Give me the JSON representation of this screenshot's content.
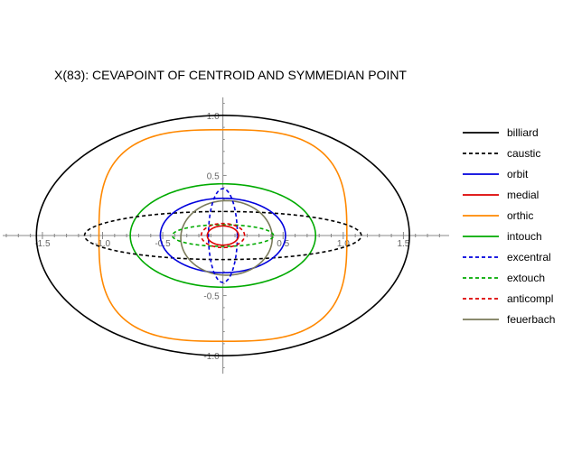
{
  "chart_data": {
    "type": "line",
    "title": "X(83): CEVAPOINT OF CENTROID AND SYMMEDIAN POINT",
    "xlabel": "",
    "ylabel": "",
    "xlim": [
      -1.83,
      1.88
    ],
    "ylim": [
      -1.15,
      1.15
    ],
    "aspect": "equal",
    "grid": false,
    "legend_position": "right",
    "x_ticks": [
      {
        "value": -1.5,
        "label": "-1.5"
      },
      {
        "value": -1.0,
        "label": "-1.0"
      },
      {
        "value": -0.5,
        "label": "-0.5"
      },
      {
        "value": 0.5,
        "label": "0.5"
      },
      {
        "value": 1.0,
        "label": "1.0"
      },
      {
        "value": 1.5,
        "label": "1.5"
      }
    ],
    "y_ticks": [
      {
        "value": 1.0,
        "label": "1.0"
      },
      {
        "value": 0.5,
        "label": "0.5"
      },
      {
        "value": -0.5,
        "label": "-0.5"
      },
      {
        "value": -1.0,
        "label": "-1.0"
      }
    ],
    "series": [
      {
        "name": "billiard",
        "color": "#000000",
        "dashed": false,
        "shape": "ellipse",
        "cx": 0,
        "cy": 0,
        "rx": 1.55,
        "ry": 1.0
      },
      {
        "name": "caustic",
        "color": "#000000",
        "dashed": true,
        "shape": "ellipse",
        "cx": 0,
        "cy": 0,
        "rx": 1.15,
        "ry": 0.2
      },
      {
        "name": "orbit",
        "color": "#0000dd",
        "dashed": false,
        "shape": "ellipse",
        "cx": 0,
        "cy": 0,
        "rx": 0.52,
        "ry": 0.31
      },
      {
        "name": "medial",
        "color": "#dd0000",
        "dashed": false,
        "shape": "ellipse",
        "cx": 0,
        "cy": 0,
        "rx": 0.13,
        "ry": 0.08
      },
      {
        "name": "orthic",
        "color": "#ff8800",
        "dashed": false,
        "shape": "superellipse",
        "cx": 0,
        "cy": 0,
        "rx": 1.03,
        "ry": 0.88,
        "n": 3
      },
      {
        "name": "intouch",
        "color": "#00aa00",
        "dashed": false,
        "shape": "ellipse",
        "cx": 0,
        "cy": 0,
        "rx": 0.77,
        "ry": 0.43
      },
      {
        "name": "excentral",
        "color": "#0000dd",
        "dashed": true,
        "shape": "ellipse",
        "cx": 0,
        "cy": 0,
        "rx": 0.12,
        "ry": 0.39
      },
      {
        "name": "extouch",
        "color": "#00aa00",
        "dashed": true,
        "shape": "ellipse",
        "cx": 0,
        "cy": 0,
        "rx": 0.42,
        "ry": 0.09
      },
      {
        "name": "anticompl",
        "color": "#dd0000",
        "dashed": true,
        "shape": "ellipse",
        "cx": 0,
        "cy": 0,
        "rx": 0.18,
        "ry": 0.1
      },
      {
        "name": "feuerbach",
        "color": "#7a7a5a",
        "dashed": false,
        "shape": "ellipse",
        "cx": 0.03,
        "cy": -0.02,
        "rx": 0.38,
        "ry": 0.31
      }
    ]
  }
}
